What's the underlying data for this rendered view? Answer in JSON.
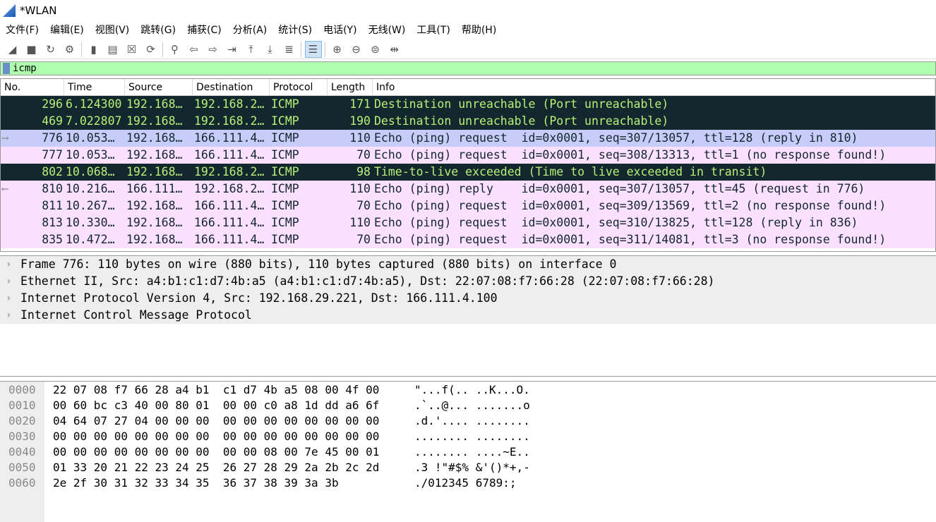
{
  "window": {
    "title": "*WLAN"
  },
  "menu": [
    "文件(F)",
    "编辑(E)",
    "视图(V)",
    "跳转(G)",
    "捕获(C)",
    "分析(A)",
    "统计(S)",
    "电话(Y)",
    "无线(W)",
    "工具(T)",
    "帮助(H)"
  ],
  "toolbar": [
    {
      "name": "start-capture",
      "glyph": "◢"
    },
    {
      "name": "stop-capture",
      "glyph": "■"
    },
    {
      "name": "restart-capture",
      "glyph": "↻"
    },
    {
      "name": "capture-options",
      "glyph": "⚙"
    },
    {
      "sep": true
    },
    {
      "name": "open-file",
      "glyph": "▮"
    },
    {
      "name": "save-file",
      "glyph": "▤"
    },
    {
      "name": "close-file",
      "glyph": "☒"
    },
    {
      "name": "reload-file",
      "glyph": "⟳"
    },
    {
      "sep": true
    },
    {
      "name": "find-packet",
      "glyph": "⚲"
    },
    {
      "name": "go-back",
      "glyph": "⇦"
    },
    {
      "name": "go-forward",
      "glyph": "⇨"
    },
    {
      "name": "go-to-packet",
      "glyph": "⇥"
    },
    {
      "name": "go-first",
      "glyph": "⤒"
    },
    {
      "name": "go-last",
      "glyph": "⤓"
    },
    {
      "name": "auto-scroll",
      "glyph": "≣"
    },
    {
      "sep": true
    },
    {
      "name": "colorize",
      "glyph": "☰",
      "active": true
    },
    {
      "sep": true
    },
    {
      "name": "zoom-in",
      "glyph": "⊕"
    },
    {
      "name": "zoom-out",
      "glyph": "⊖"
    },
    {
      "name": "zoom-reset",
      "glyph": "⊜"
    },
    {
      "name": "resize-columns",
      "glyph": "⇹"
    }
  ],
  "filter": {
    "value": "icmp"
  },
  "columns": [
    "No.",
    "Time",
    "Source",
    "Destination",
    "Protocol",
    "Length",
    "Info"
  ],
  "colors": {
    "error_bg": "#12272e",
    "error_fg": "#b8f078",
    "selected_bg": "#c8ccf8",
    "icmp_bg": "#fce0ff",
    "filter_bg": "#afffaf"
  },
  "packets": [
    {
      "no": "296",
      "time": "6.124300",
      "src": "192.168…",
      "dst": "192.168.2…",
      "proto": "ICMP",
      "len": "171",
      "info": "Destination unreachable (Port unreachable)",
      "style": "err",
      "mark": ""
    },
    {
      "no": "469",
      "time": "7.022807",
      "src": "192.168…",
      "dst": "192.168.2…",
      "proto": "ICMP",
      "len": "190",
      "info": "Destination unreachable (Port unreachable)",
      "style": "err",
      "mark": ""
    },
    {
      "no": "776",
      "time": "10.053…",
      "src": "192.168…",
      "dst": "166.111.4…",
      "proto": "ICMP",
      "len": "110",
      "info": "Echo (ping) request  id=0x0001, seq=307/13057, ttl=128 (reply in 810)",
      "style": "sel",
      "mark": "⟶"
    },
    {
      "no": "777",
      "time": "10.053…",
      "src": "192.168…",
      "dst": "166.111.4…",
      "proto": "ICMP",
      "len": "70",
      "info": "Echo (ping) request  id=0x0001, seq=308/13313, ttl=1 (no response found!)",
      "style": "pink",
      "mark": ""
    },
    {
      "no": "802",
      "time": "10.068…",
      "src": "192.168…",
      "dst": "192.168.2…",
      "proto": "ICMP",
      "len": "98",
      "info": "Time-to-live exceeded (Time to live exceeded in transit)",
      "style": "err",
      "mark": ""
    },
    {
      "no": "810",
      "time": "10.216…",
      "src": "166.111…",
      "dst": "192.168.2…",
      "proto": "ICMP",
      "len": "110",
      "info": "Echo (ping) reply    id=0x0001, seq=307/13057, ttl=45 (request in 776)",
      "style": "pink",
      "mark": "⟵"
    },
    {
      "no": "811",
      "time": "10.267…",
      "src": "192.168…",
      "dst": "166.111.4…",
      "proto": "ICMP",
      "len": "70",
      "info": "Echo (ping) request  id=0x0001, seq=309/13569, ttl=2 (no response found!)",
      "style": "pink",
      "mark": ""
    },
    {
      "no": "813",
      "time": "10.330…",
      "src": "192.168…",
      "dst": "166.111.4…",
      "proto": "ICMP",
      "len": "110",
      "info": "Echo (ping) request  id=0x0001, seq=310/13825, ttl=128 (reply in 836)",
      "style": "pink",
      "mark": ""
    },
    {
      "no": "835",
      "time": "10.472…",
      "src": "192.168…",
      "dst": "166.111.4…",
      "proto": "ICMP",
      "len": "70",
      "info": "Echo (ping) request  id=0x0001, seq=311/14081, ttl=3 (no response found!)",
      "style": "pink",
      "mark": ""
    }
  ],
  "details": [
    "Frame 776: 110 bytes on wire (880 bits), 110 bytes captured (880 bits) on interface 0",
    "Ethernet II, Src: a4:b1:c1:d7:4b:a5 (a4:b1:c1:d7:4b:a5), Dst: 22:07:08:f7:66:28 (22:07:08:f7:66:28)",
    "Internet Protocol Version 4, Src: 192.168.29.221, Dst: 166.111.4.100",
    "Internet Control Message Protocol"
  ],
  "hex": [
    {
      "off": "0000",
      "bytes": "22 07 08 f7 66 28 a4 b1  c1 d7 4b a5 08 00 4f 00",
      "ascii": "\"...f(.. ..K...O."
    },
    {
      "off": "0010",
      "bytes": "00 60 bc c3 40 00 80 01  00 00 c0 a8 1d dd a6 6f",
      "ascii": ".`..@... .......o"
    },
    {
      "off": "0020",
      "bytes": "04 64 07 27 04 00 00 00  00 00 00 00 00 00 00 00",
      "ascii": ".d.'.... ........"
    },
    {
      "off": "0030",
      "bytes": "00 00 00 00 00 00 00 00  00 00 00 00 00 00 00 00",
      "ascii": "........ ........"
    },
    {
      "off": "0040",
      "bytes": "00 00 00 00 00 00 00 00  00 00 08 00 7e 45 00 01",
      "ascii": "........ ....~E.."
    },
    {
      "off": "0050",
      "bytes": "01 33 20 21 22 23 24 25  26 27 28 29 2a 2b 2c 2d",
      "ascii": ".3 !\"#$% &'()*+,-"
    },
    {
      "off": "0060",
      "bytes": "2e 2f 30 31 32 33 34 35  36 37 38 39 3a 3b",
      "ascii": "./012345 6789:;"
    }
  ]
}
